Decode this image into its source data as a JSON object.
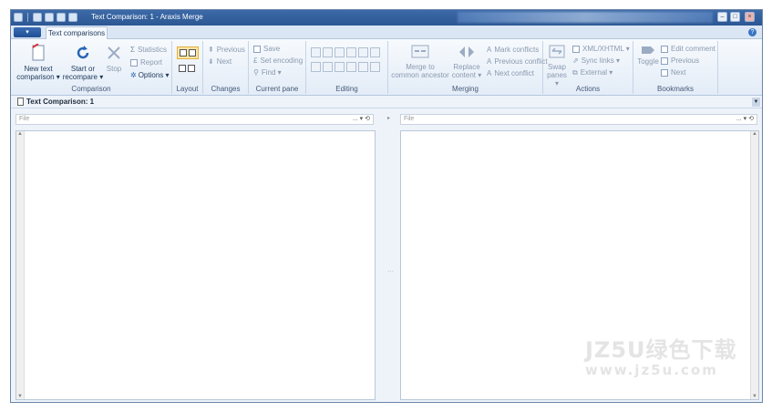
{
  "window": {
    "title": "Text Comparison: 1 - Araxis Merge"
  },
  "tabs": {
    "active": "Text comparisons",
    "app_menu": "▾"
  },
  "groups": {
    "comparison": "Comparison",
    "layout": "Layout",
    "changes": "Changes",
    "current_pane": "Current pane",
    "editing": "Editing",
    "merging": "Merging",
    "actions": "Actions",
    "bookmarks": "Bookmarks"
  },
  "comparison": {
    "new_line1": "New text",
    "new_line2": "comparison ▾",
    "start_line1": "Start or",
    "start_line2": "recompare ▾",
    "stop": "Stop",
    "statistics": "Statistics",
    "report": "Report",
    "options": "Options ▾"
  },
  "changes": {
    "previous": "Previous",
    "next": "Next"
  },
  "current_pane": {
    "save": "Save",
    "set_encoding": "Set encoding",
    "find": "Find ▾"
  },
  "merging": {
    "merge_line1": "Merge to",
    "merge_line2": "common ancestor",
    "replace_line1": "Replace",
    "replace_line2": "content ▾",
    "mark_conflicts": "Mark conflicts",
    "previous_conflict": "Previous conflict",
    "next_conflict": "Next conflict"
  },
  "actions": {
    "swap_line1": "Swap",
    "swap_line2": "panes ▾",
    "xml": "XML/XHTML ▾",
    "sync_links": "Sync links ▾",
    "external": "External ▾"
  },
  "bookmarks": {
    "toggle": "Toggle",
    "edit_comment": "Edit comment",
    "previous": "Previous",
    "next": "Next"
  },
  "document": {
    "tab_title": "Text Comparison: 1"
  },
  "left_pane": {
    "file_placeholder": "File",
    "controls": "... ▾ ⟲"
  },
  "right_pane": {
    "file_placeholder": "File",
    "controls": "... ▾ ⟲"
  },
  "watermark": {
    "line1": "JZ5U绿色下载",
    "line2": "www.jz5u.com"
  },
  "colors": {
    "titlebar": "#2c5793",
    "ribbon": "#e3ecf7",
    "accent": "#3a75c4"
  }
}
